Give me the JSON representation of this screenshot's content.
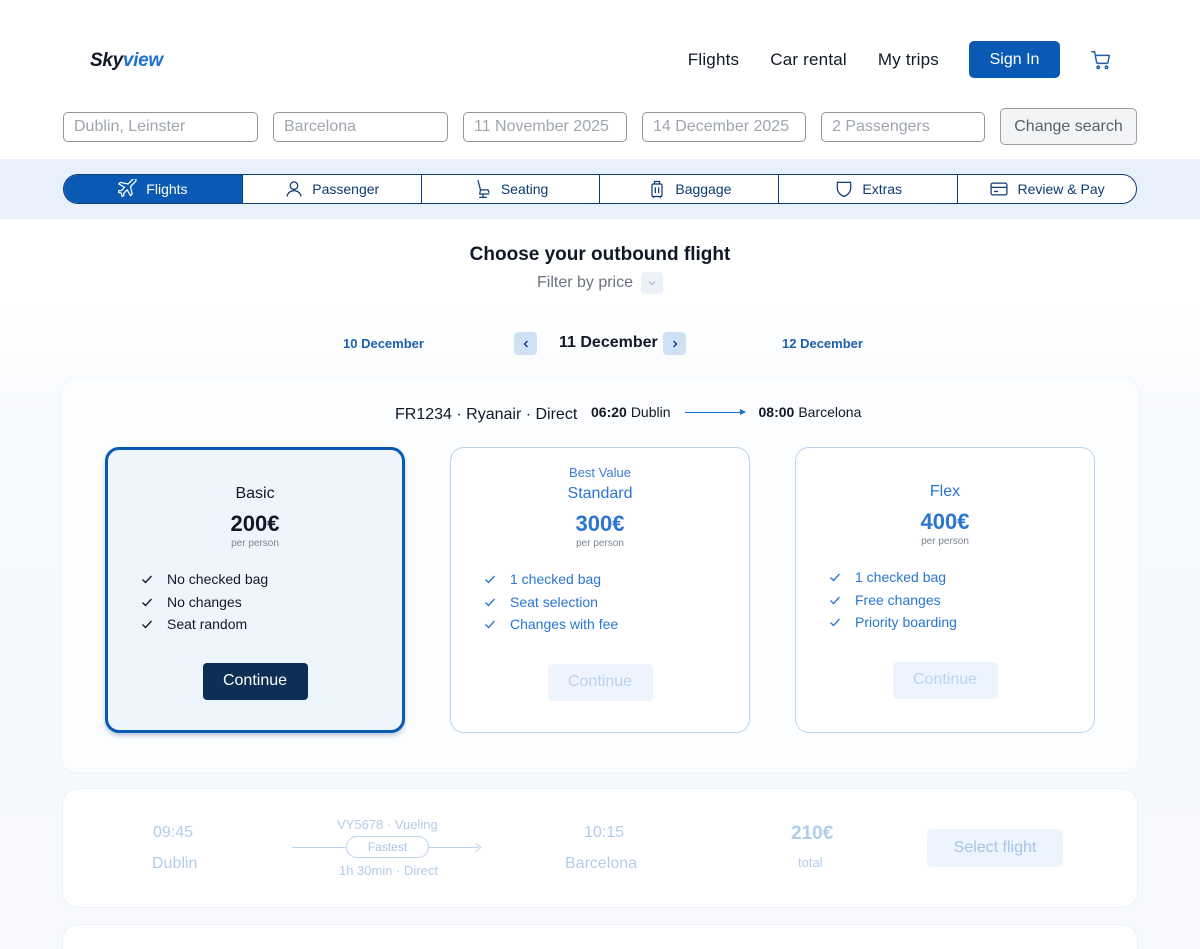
{
  "header": {
    "logo_main": "Sky",
    "logo_accent": "view",
    "nav": [
      "Flights",
      "Car rental",
      "My trips"
    ],
    "signin_label": "Sign In",
    "cart_icon": "cart-icon"
  },
  "search": {
    "origin": "Dublin, Leinster",
    "destination": "Barcelona",
    "depart_date": "11 November 2025",
    "return_date": "14 December 2025",
    "passengers": "2 Passengers",
    "change_label": "Change search"
  },
  "steps": [
    {
      "label": "Flights",
      "icon": "plane-icon",
      "active": true
    },
    {
      "label": "Passenger",
      "icon": "user-icon",
      "active": false
    },
    {
      "label": "Seating",
      "icon": "seat-icon",
      "active": false
    },
    {
      "label": "Baggage",
      "icon": "suitcase-icon",
      "active": false
    },
    {
      "label": "Extras",
      "icon": "shield-icon",
      "active": false
    },
    {
      "label": "Review & Pay",
      "icon": "card-icon",
      "active": false
    }
  ],
  "main": {
    "heading": "Choose your outbound flight",
    "filter_label": "Filter by price"
  },
  "dates": {
    "prev": "10 December",
    "current": "11 December",
    "next": "12 December"
  },
  "flight1": {
    "meta": "FR1234 · Ryanair · Direct",
    "depart_time": "06:20",
    "depart_city": "Dublin",
    "arrive_time": "08:00",
    "arrive_city": "Barcelona",
    "fares": {
      "basic": {
        "name": "Basic",
        "price": "200€",
        "per": "per person",
        "features": [
          "No checked bag",
          "No changes",
          "Seat random"
        ],
        "button": "Continue"
      },
      "standard": {
        "tag": "Best Value",
        "name": "Standard",
        "price": "300€",
        "per": "per person",
        "features": [
          "1 checked bag",
          "Seat selection",
          "Changes with fee"
        ],
        "button": "Continue"
      },
      "flex": {
        "name": "Flex",
        "price": "400€",
        "per": "per person",
        "features": [
          "1 checked bag",
          "Free changes",
          "Priority boarding"
        ],
        "button": "Continue"
      }
    }
  },
  "flight2": {
    "depart_time": "09:45",
    "depart_city": "Dublin",
    "meta": "VY5678 · Vueling",
    "badge": "Fastest",
    "duration": "1h 30min · Direct",
    "arrive_time": "10:15",
    "arrive_city": "Barcelona",
    "price": "210€",
    "price_note": "total",
    "button": "Select flight"
  },
  "colors": {
    "primary": "#0a5ab5",
    "dark_button": "#0d2f55",
    "accent_text": "#2a76d2",
    "step_band": "#e8f1fb"
  }
}
